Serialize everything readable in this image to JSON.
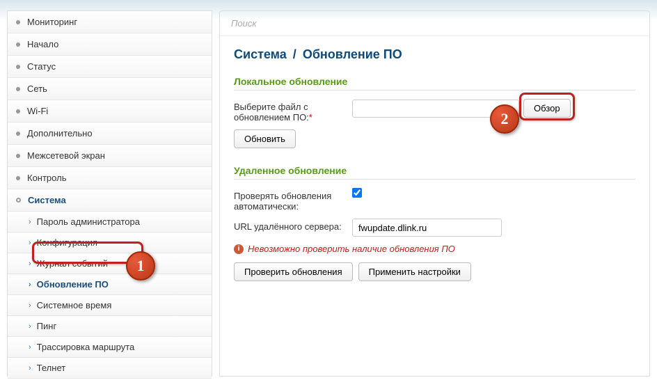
{
  "search": {
    "placeholder": "Поиск"
  },
  "breadcrumb": {
    "parent": "Система",
    "current": "Обновление ПО"
  },
  "sidebar": {
    "items": [
      {
        "label": "Мониторинг"
      },
      {
        "label": "Начало"
      },
      {
        "label": "Статус"
      },
      {
        "label": "Сеть"
      },
      {
        "label": "Wi-Fi"
      },
      {
        "label": "Дополнительно"
      },
      {
        "label": "Межсетевой экран"
      },
      {
        "label": "Контроль"
      },
      {
        "label": "Система"
      }
    ],
    "subitems": [
      {
        "label": "Пароль администратора"
      },
      {
        "label": "Конфигурация"
      },
      {
        "label": "Журнал событий"
      },
      {
        "label": "Обновление ПО"
      },
      {
        "label": "Системное время"
      },
      {
        "label": "Пинг"
      },
      {
        "label": "Трассировка маршрута"
      },
      {
        "label": "Телнет"
      }
    ]
  },
  "local_update": {
    "title": "Локальное обновление",
    "file_label": "Выберите файл с обновлением ПО:",
    "browse_btn": "Обзор",
    "update_btn": "Обновить"
  },
  "remote_update": {
    "title": "Удаленное обновление",
    "auto_check_label": "Проверять обновления автоматически:",
    "auto_check_value": true,
    "url_label": "URL удалённого сервера:",
    "url_value": "fwupdate.dlink.ru",
    "error_msg": "Невозможно проверить наличие обновления ПО",
    "check_btn": "Проверить обновления",
    "apply_btn": "Применить настройки"
  },
  "annotations": {
    "badge1": "1",
    "badge2": "2"
  }
}
